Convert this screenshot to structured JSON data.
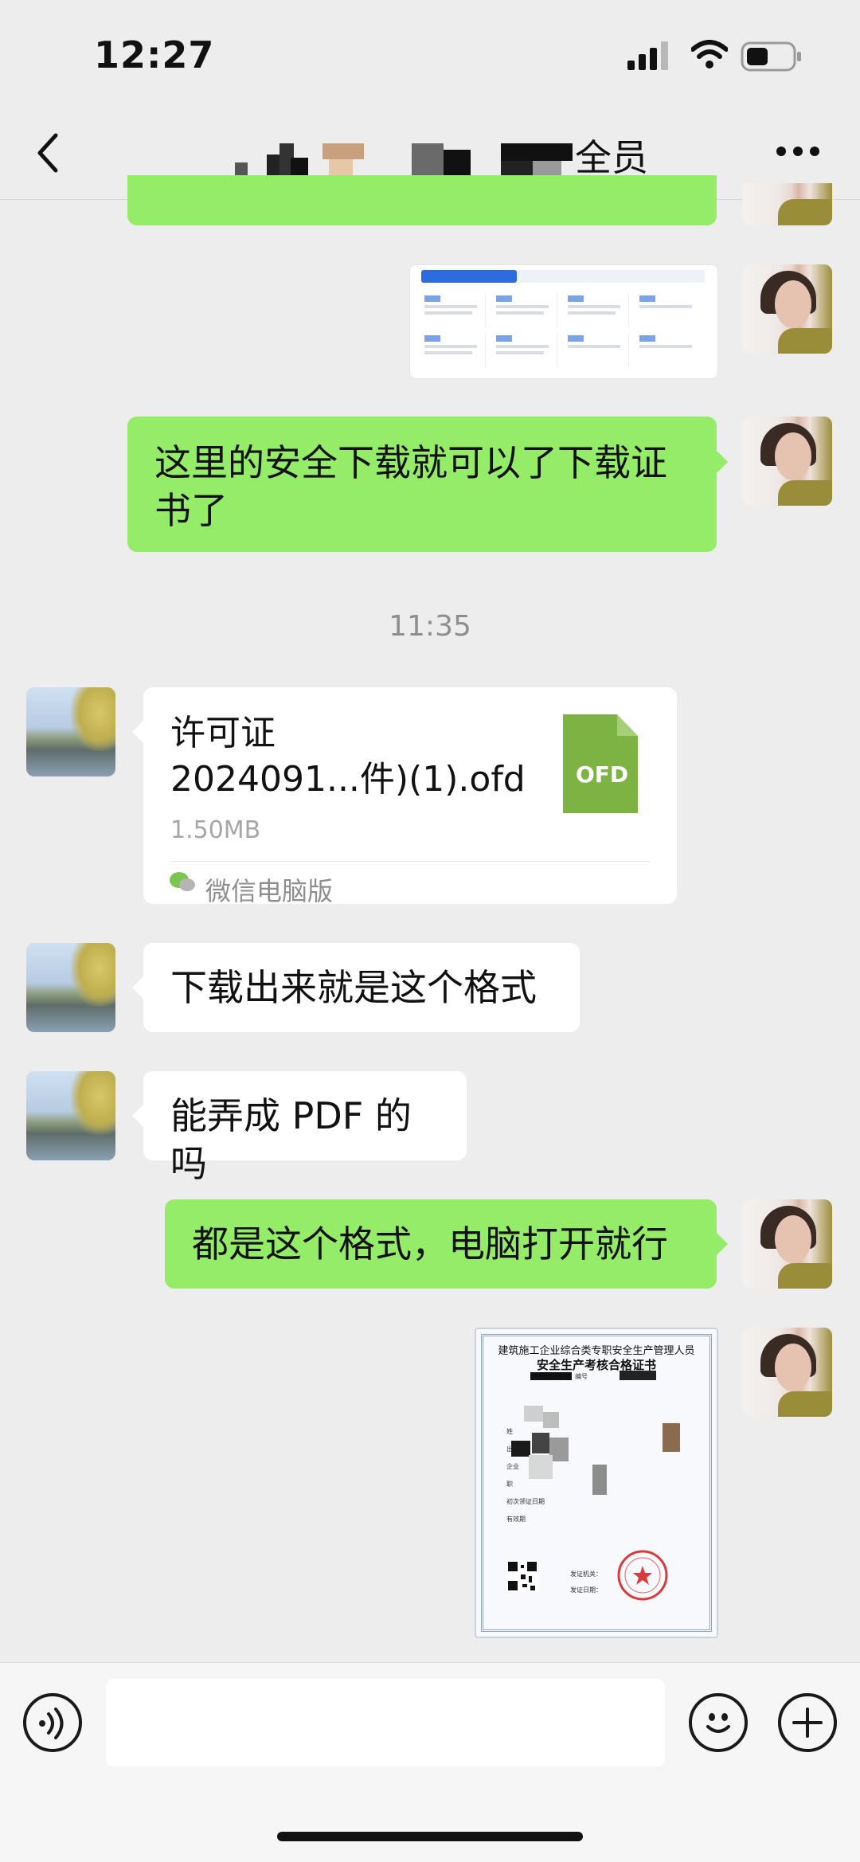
{
  "status_bar": {
    "time": "12:27"
  },
  "nav": {
    "title_visible": "全员"
  },
  "messages": {
    "me_text_1": "这里的安全下载就可以了下载证书了",
    "timestamp_1": "11:35",
    "file": {
      "name_line1": "许可证",
      "name_line2": "2024091...件)(1).ofd",
      "size": "1.50MB",
      "source": "微信电脑版",
      "icon_label": "OFD"
    },
    "other_text_1": "下载出来就是这个格式",
    "other_text_2": "能弄成 PDF 的吗",
    "me_text_2": "都是这个格式，电脑打开就行"
  },
  "screenshot_preview": {
    "tabs": [
      "",
      "",
      ""
    ],
    "services": []
  },
  "certificate": {
    "title_line1": "建筑施工企业综合类专职安全生产管理人员",
    "title_line2": "安全生产考核合格证书",
    "cert_no_label": "编号",
    "fields": [
      "姓",
      "出",
      "企业",
      "职",
      "初次领证日期",
      "有效期"
    ],
    "issuer_label": "发证机关：",
    "issue_date_label": "发证日期："
  },
  "colors": {
    "green_bubble": "#95ec69",
    "background": "#ededed",
    "ofd_green": "#7cb342"
  },
  "icons": [
    "back-icon",
    "more-icon",
    "voice-icon",
    "emoji-icon",
    "add-icon",
    "wechat-pc-icon"
  ]
}
